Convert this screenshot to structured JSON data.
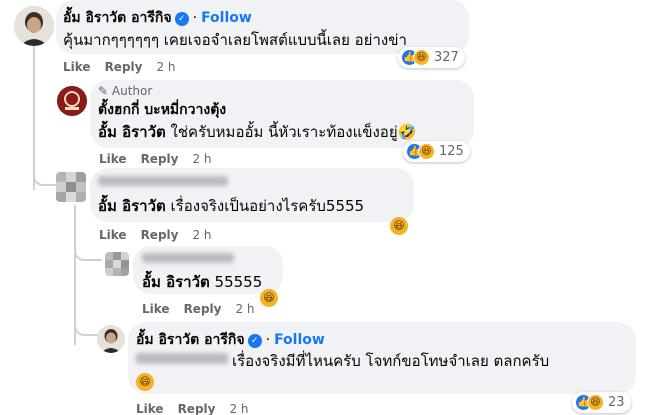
{
  "comments": [
    {
      "name": "อั้ม อิราวัต อารีกิจ",
      "follow": "Follow",
      "dot": "·",
      "text": "คุ้นมากๆๆๆๆๆๆ เคยเจอจำเลยโพสต์แบบนี้เลย อย่างข่า",
      "like": "Like",
      "reply": "Reply",
      "time": "2 h",
      "reaction_count": "327",
      "avatar_icon": "portrait-avatar"
    },
    {
      "badge": "Author",
      "name": "ตั้งฮกกี่ บะหมี่กวางตุ้ง",
      "mention": "อั้ม อิราวัต",
      "text": " ใช่ครับหมออั้ม นี้หัวเราะท้องแข็งอยู่🤣",
      "like": "Like",
      "reply": "Reply",
      "time": "2 h",
      "reaction_count": "125",
      "avatar_icon": "shop-logo-avatar"
    },
    {
      "mention": "อั้ม อิราวัต",
      "text": " เรื่องจริงเป็นอย่างไรครับ5555",
      "like": "Like",
      "reply": "Reply",
      "time": "2 h",
      "reaction_icon": "haha-emoji"
    },
    {
      "mention": "อั้ม อิราวัต",
      "text": " 55555",
      "like": "Like",
      "reply": "Reply",
      "time": "2 h",
      "reaction_icon": "haha-emoji"
    },
    {
      "name": "อั้ม อิราวัต อารีกิจ",
      "follow": "Follow",
      "dot": "·",
      "text": "เรื่องจริงมีที่ไหนครับ โจทก์ขอโทษจำเลย ตลกครับ",
      "emoji_icon": "smile-emoji",
      "like": "Like",
      "reply": "Reply",
      "time": "2 h",
      "reaction_count": "23"
    }
  ],
  "colors": {
    "bubble": "#f0f2f5",
    "link_blue": "#1877f2",
    "meta_gray": "#65676b"
  }
}
